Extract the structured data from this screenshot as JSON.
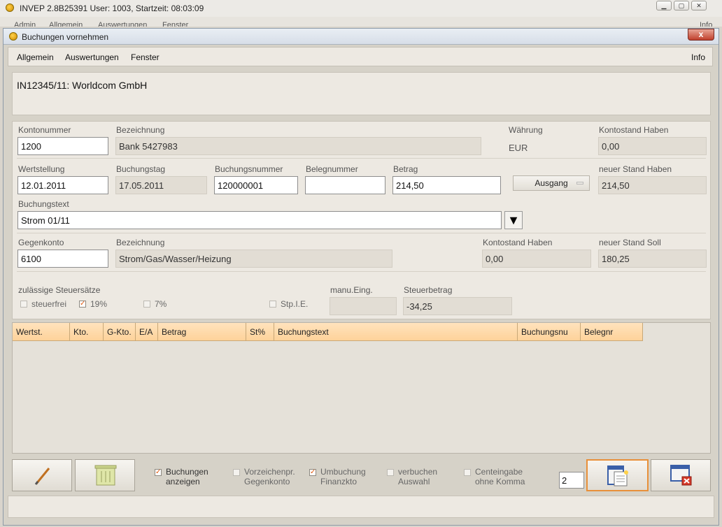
{
  "app": {
    "title": "INVEP 2.8B25391 User: 1003, Startzeit: 08:03:09",
    "menu_partial": [
      "Admin",
      "Allgemein",
      "Auswertungen",
      "Fenster",
      "Info"
    ]
  },
  "window": {
    "title": "Buchungen vornehmen",
    "close_label": "x"
  },
  "menu": {
    "items": [
      "Allgemein",
      "Auswertungen",
      "Fenster"
    ],
    "info": "Info"
  },
  "header": {
    "text": "IN12345/11: Worldcom GmbH"
  },
  "konto": {
    "nummer_label": "Kontonummer",
    "nummer": "1200",
    "bez_label": "Bezeichnung",
    "bez": "Bank 5427983",
    "waehrung_label": "Währung",
    "waehrung": "EUR",
    "stand_label": "Kontostand Haben",
    "stand": "0,00"
  },
  "buchung": {
    "wert_label": "Wertstellung",
    "wert": "12.01.2011",
    "tag_label": "Buchungstag",
    "tag": "17.05.2011",
    "nr_label": "Buchungsnummer",
    "nr": "120000001",
    "beleg_label": "Belegnummer",
    "beleg": "",
    "betrag_label": "Betrag",
    "betrag": "214,50",
    "richtung": "Ausgang",
    "neu_label": "neuer Stand Haben",
    "neu": "214,50",
    "text_label": "Buchungstext",
    "text": "Strom 01/11"
  },
  "gegen": {
    "nr_label": "Gegenkonto",
    "nr": "6100",
    "bez_label": "Bezeichnung",
    "bez": "Strom/Gas/Wasser/Heizung",
    "stand_label": "Kontostand Haben",
    "stand": "0,00",
    "soll_label": "neuer Stand Soll",
    "soll": "180,25"
  },
  "steuer": {
    "title": "zulässige Steuersätze",
    "opt_frei": "steuerfrei",
    "opt_19": "19%",
    "opt_7": "7%",
    "opt_stp": "Stp.I.E.",
    "manu_label": "manu.Eing.",
    "manu": "",
    "betrag_label": "Steuerbetrag",
    "betrag": "-34,25"
  },
  "table": {
    "columns": [
      "Wertst.",
      "Kto.",
      "G-Kto.",
      "E/A",
      "Betrag",
      "St%",
      "Buchungstext",
      "Buchungsnu",
      "Belegnr"
    ]
  },
  "options": {
    "anzeigen_1": "Buchungen",
    "anzeigen_2": "anzeigen",
    "vorz_1": "Vorzeichenpr.",
    "vorz_2": "Gegenkonto",
    "umb_1": "Umbuchung",
    "umb_2": "Finanzkto",
    "verb_1": "verbuchen",
    "verb_2": "Auswahl",
    "cent_1": "Centeingabe",
    "cent_2": "ohne Komma",
    "count": "2"
  },
  "colors": {
    "accent_check": "#e05a10",
    "header_orange": "#fed29a",
    "focus_border": "#e8903a"
  }
}
